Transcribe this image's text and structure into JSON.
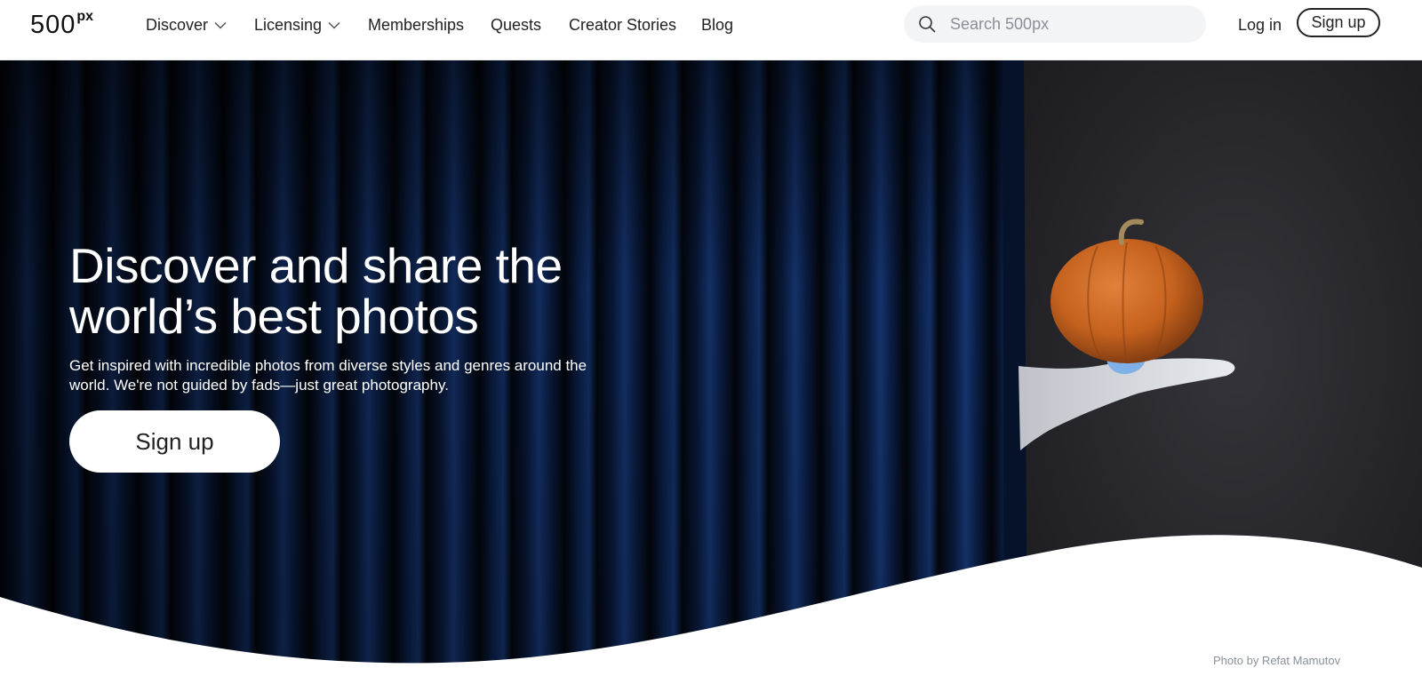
{
  "brand": {
    "logo_text": "500",
    "logo_superscript": "px"
  },
  "nav": {
    "items": [
      {
        "label": "Discover",
        "has_dropdown": true
      },
      {
        "label": "Licensing",
        "has_dropdown": true
      },
      {
        "label": "Memberships",
        "has_dropdown": false
      },
      {
        "label": "Quests",
        "has_dropdown": false
      },
      {
        "label": "Creator Stories",
        "has_dropdown": false
      },
      {
        "label": "Blog",
        "has_dropdown": false
      }
    ]
  },
  "search": {
    "placeholder": "Search 500px",
    "value": "",
    "icon": "search-icon"
  },
  "auth": {
    "login_label": "Log in",
    "signup_label": "Sign up"
  },
  "hero": {
    "title": "Discover and share the world’s best photos",
    "subtitle": "Get inspired with incredible photos from diverse styles and genres around the world. We're not guided by fads—just great photography.",
    "cta_label": "Sign up",
    "photo_credit": "Photo by Refat Mamutov"
  },
  "colors": {
    "accent_text": "#222222",
    "search_bg": "#f3f4f6",
    "curtain_blue": "#0e2a5c",
    "backdrop": "#2a2a2d",
    "pumpkin": "#c8651f"
  }
}
